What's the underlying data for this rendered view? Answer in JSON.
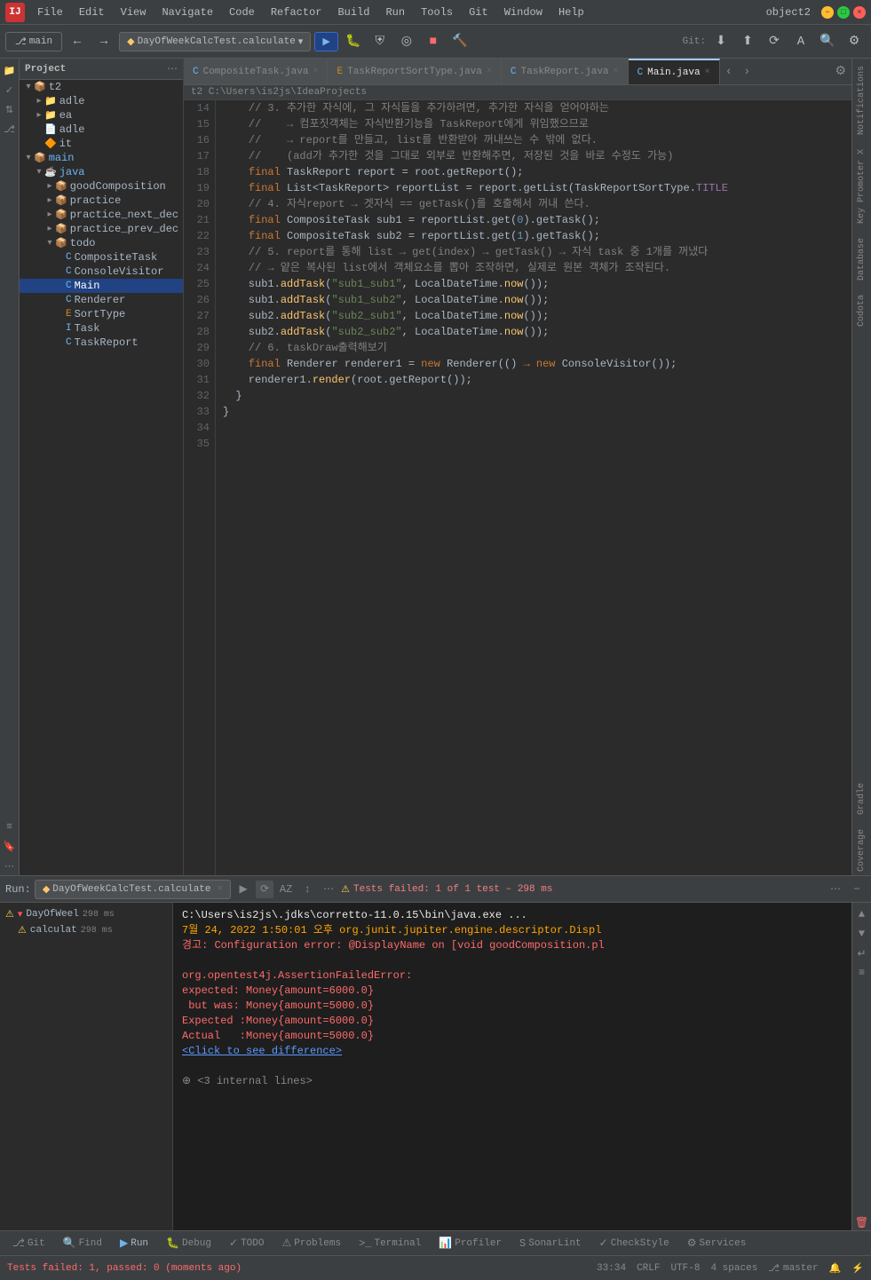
{
  "window": {
    "title": "object2",
    "logo": "IJ"
  },
  "menu": {
    "items": [
      "File",
      "Edit",
      "View",
      "Navigate",
      "Code",
      "Refactor",
      "Build",
      "Run",
      "Tools",
      "Git",
      "Window",
      "Help"
    ]
  },
  "toolbar": {
    "branch": "main",
    "run_config": "DayOfWeekCalcTest.calculate",
    "git_label": "Git:"
  },
  "tabs": [
    {
      "label": "CompositeTask.java",
      "active": false
    },
    {
      "label": "TaskReportSortType.java",
      "active": false
    },
    {
      "label": "TaskReport.java",
      "active": false
    },
    {
      "label": "Main.java",
      "active": true
    }
  ],
  "breadcrumb": {
    "path": "t2  C:\\Users\\is2js\\IdeaProjects"
  },
  "file_tree": {
    "project_label": "Project",
    "items": [
      {
        "label": "t2",
        "indent": 0,
        "type": "root",
        "expanded": true
      },
      {
        "label": "adle",
        "indent": 1,
        "type": "folder",
        "expanded": false
      },
      {
        "label": "ea",
        "indent": 1,
        "type": "folder",
        "expanded": false
      },
      {
        "label": "adle",
        "indent": 1,
        "type": "file",
        "expanded": false
      },
      {
        "label": "it",
        "indent": 1,
        "type": "file",
        "expanded": false,
        "selected": false
      },
      {
        "label": "main",
        "indent": 1,
        "type": "module",
        "expanded": true
      },
      {
        "label": "java",
        "indent": 2,
        "type": "folder-src",
        "expanded": true
      },
      {
        "label": "goodComposition",
        "indent": 3,
        "type": "package",
        "expanded": false
      },
      {
        "label": "practice",
        "indent": 3,
        "type": "package",
        "expanded": false
      },
      {
        "label": "practice_next_dec",
        "indent": 3,
        "type": "package",
        "expanded": false
      },
      {
        "label": "practice_prev_dec",
        "indent": 3,
        "type": "package",
        "expanded": false
      },
      {
        "label": "todo",
        "indent": 3,
        "type": "package",
        "expanded": true
      },
      {
        "label": "CompositeTask",
        "indent": 4,
        "type": "class",
        "expanded": false
      },
      {
        "label": "ConsoleVisitor",
        "indent": 4,
        "type": "class",
        "expanded": false
      },
      {
        "label": "Main",
        "indent": 4,
        "type": "class",
        "expanded": false,
        "selected": true
      },
      {
        "label": "Renderer",
        "indent": 4,
        "type": "class",
        "expanded": false
      },
      {
        "label": "SortType",
        "indent": 4,
        "type": "enum",
        "expanded": false
      },
      {
        "label": "Task",
        "indent": 4,
        "type": "interface",
        "expanded": false
      },
      {
        "label": "TaskReport",
        "indent": 4,
        "type": "class",
        "expanded": false
      }
    ]
  },
  "code": {
    "lines": [
      {
        "num": 14,
        "text": "    // 3. 추가한 자식에, 그 자식들을 추가하려면, 추가한 자식을 얻어야하는"
      },
      {
        "num": 15,
        "text": "    //    → 컴포짓객체는 자식반환기능을 TaskReport에게 위임했으므로"
      },
      {
        "num": 16,
        "text": "    //    → report를 만들고, list를 반환받아 꺼내쓰는 수 밖에 없다."
      },
      {
        "num": 17,
        "text": "    //    (add가 추가한 것을 그대로 외부로 반환해주면, 저장된 것을 바로 수정도 가능)"
      },
      {
        "num": 18,
        "text": "    final TaskReport report = root.getReport();"
      },
      {
        "num": 19,
        "text": "    final List<TaskReport> reportList = report.getList(TaskReportSortType.TITLE"
      },
      {
        "num": 20,
        "text": "    // 4. 자식report → 겟자식 == getTask()를 호출해서 꺼내 쓴다."
      },
      {
        "num": 21,
        "text": "    final CompositeTask sub1 = reportList.get(0).getTask();"
      },
      {
        "num": 22,
        "text": "    final CompositeTask sub2 = reportList.get(1).getTask();"
      },
      {
        "num": 23,
        "text": ""
      },
      {
        "num": 24,
        "text": "    // 5. report를 통해 list → get(index) → getTask() → 자식 task 중 1개를 꺼냈다"
      },
      {
        "num": 25,
        "text": "    // → 얕은 복사된 list에서 객체요소를 뽑아 조작하면, 실제로 원본 객체가 조작된다."
      },
      {
        "num": 26,
        "text": "    sub1.addTask(\"sub1_sub1\", LocalDateTime.now());"
      },
      {
        "num": 27,
        "text": "    sub1.addTask(\"sub1_sub2\", LocalDateTime.now());"
      },
      {
        "num": 28,
        "text": "    sub2.addTask(\"sub2_sub1\", LocalDateTime.now());"
      },
      {
        "num": 29,
        "text": "    sub2.addTask(\"sub2_sub2\", LocalDateTime.now());"
      },
      {
        "num": 30,
        "text": ""
      },
      {
        "num": 31,
        "text": "    // 6. taskDraw출력해보기"
      },
      {
        "num": 32,
        "text": "    final Renderer renderer1 = new Renderer(() → new ConsoleVisitor());"
      },
      {
        "num": 33,
        "text": "    renderer1.render(root.getReport());"
      },
      {
        "num": 34,
        "text": "  }"
      },
      {
        "num": 35,
        "text": "}"
      }
    ]
  },
  "run_panel": {
    "tab_label": "Run:",
    "run_config": "DayOfWeekCalcTest.calculate",
    "test_status": "Tests failed: 1 of 1 test – 298 ms",
    "test_items": [
      {
        "label": "DayOfWeel",
        "time": "298 ms",
        "status": "fail"
      },
      {
        "label": "calculat",
        "time": "298 ms",
        "status": "warn"
      }
    ],
    "console_lines": [
      {
        "text": "C:\\Users\\is2js\\.jdks\\corretto-11.0.15\\bin\\java.exe ...",
        "style": "white"
      },
      {
        "text": "7월 24, 2022 1:50:01 오후 org.junit.jupiter.engine.descriptor.Displ",
        "style": "orange"
      },
      {
        "text": "경고: Configuration error: @DisplayName on [void goodComposition.pl",
        "style": "red"
      },
      {
        "text": "",
        "style": "normal"
      },
      {
        "text": "org.opentest4j.AssertionFailedError:",
        "style": "red"
      },
      {
        "text": "expected: Money{amount=6000.0}",
        "style": "red"
      },
      {
        "text": " but was: Money{amount=5000.0}",
        "style": "red"
      },
      {
        "text": "Expected :Money{amount=6000.0}",
        "style": "red"
      },
      {
        "text": "Actual   :Money{amount=5000.0}",
        "style": "red"
      },
      {
        "text": "<Click to see difference>",
        "style": "link"
      },
      {
        "text": "",
        "style": "normal"
      },
      {
        "text": "⊕ <3 internal lines>",
        "style": "gray"
      }
    ]
  },
  "status_bar": {
    "fail_text": "Tests failed: 1, passed: 0 (moments ago)",
    "position": "33:34",
    "encoding": "CRLF",
    "charset": "UTF-8",
    "indent": "4 spaces",
    "branch": "master"
  },
  "bottom_tools": {
    "items": [
      {
        "label": "Git",
        "icon": "⎇"
      },
      {
        "label": "Find",
        "icon": "🔍"
      },
      {
        "label": "Run",
        "icon": "▶"
      },
      {
        "label": "Debug",
        "icon": "🐛"
      },
      {
        "label": "TODO",
        "icon": "✓"
      },
      {
        "label": "Problems",
        "icon": "⚠"
      },
      {
        "label": "Terminal",
        "icon": ">"
      },
      {
        "label": "Profiler",
        "icon": "📊"
      },
      {
        "label": "SonarLint",
        "icon": "S"
      },
      {
        "label": "CheckStyle",
        "icon": "✓"
      },
      {
        "label": "Services",
        "icon": "⚙"
      }
    ]
  },
  "right_sidebar": {
    "items": [
      "Notifications",
      "Key Promoter X",
      "Database",
      "Codota",
      "Gradle",
      "Coverage"
    ]
  }
}
